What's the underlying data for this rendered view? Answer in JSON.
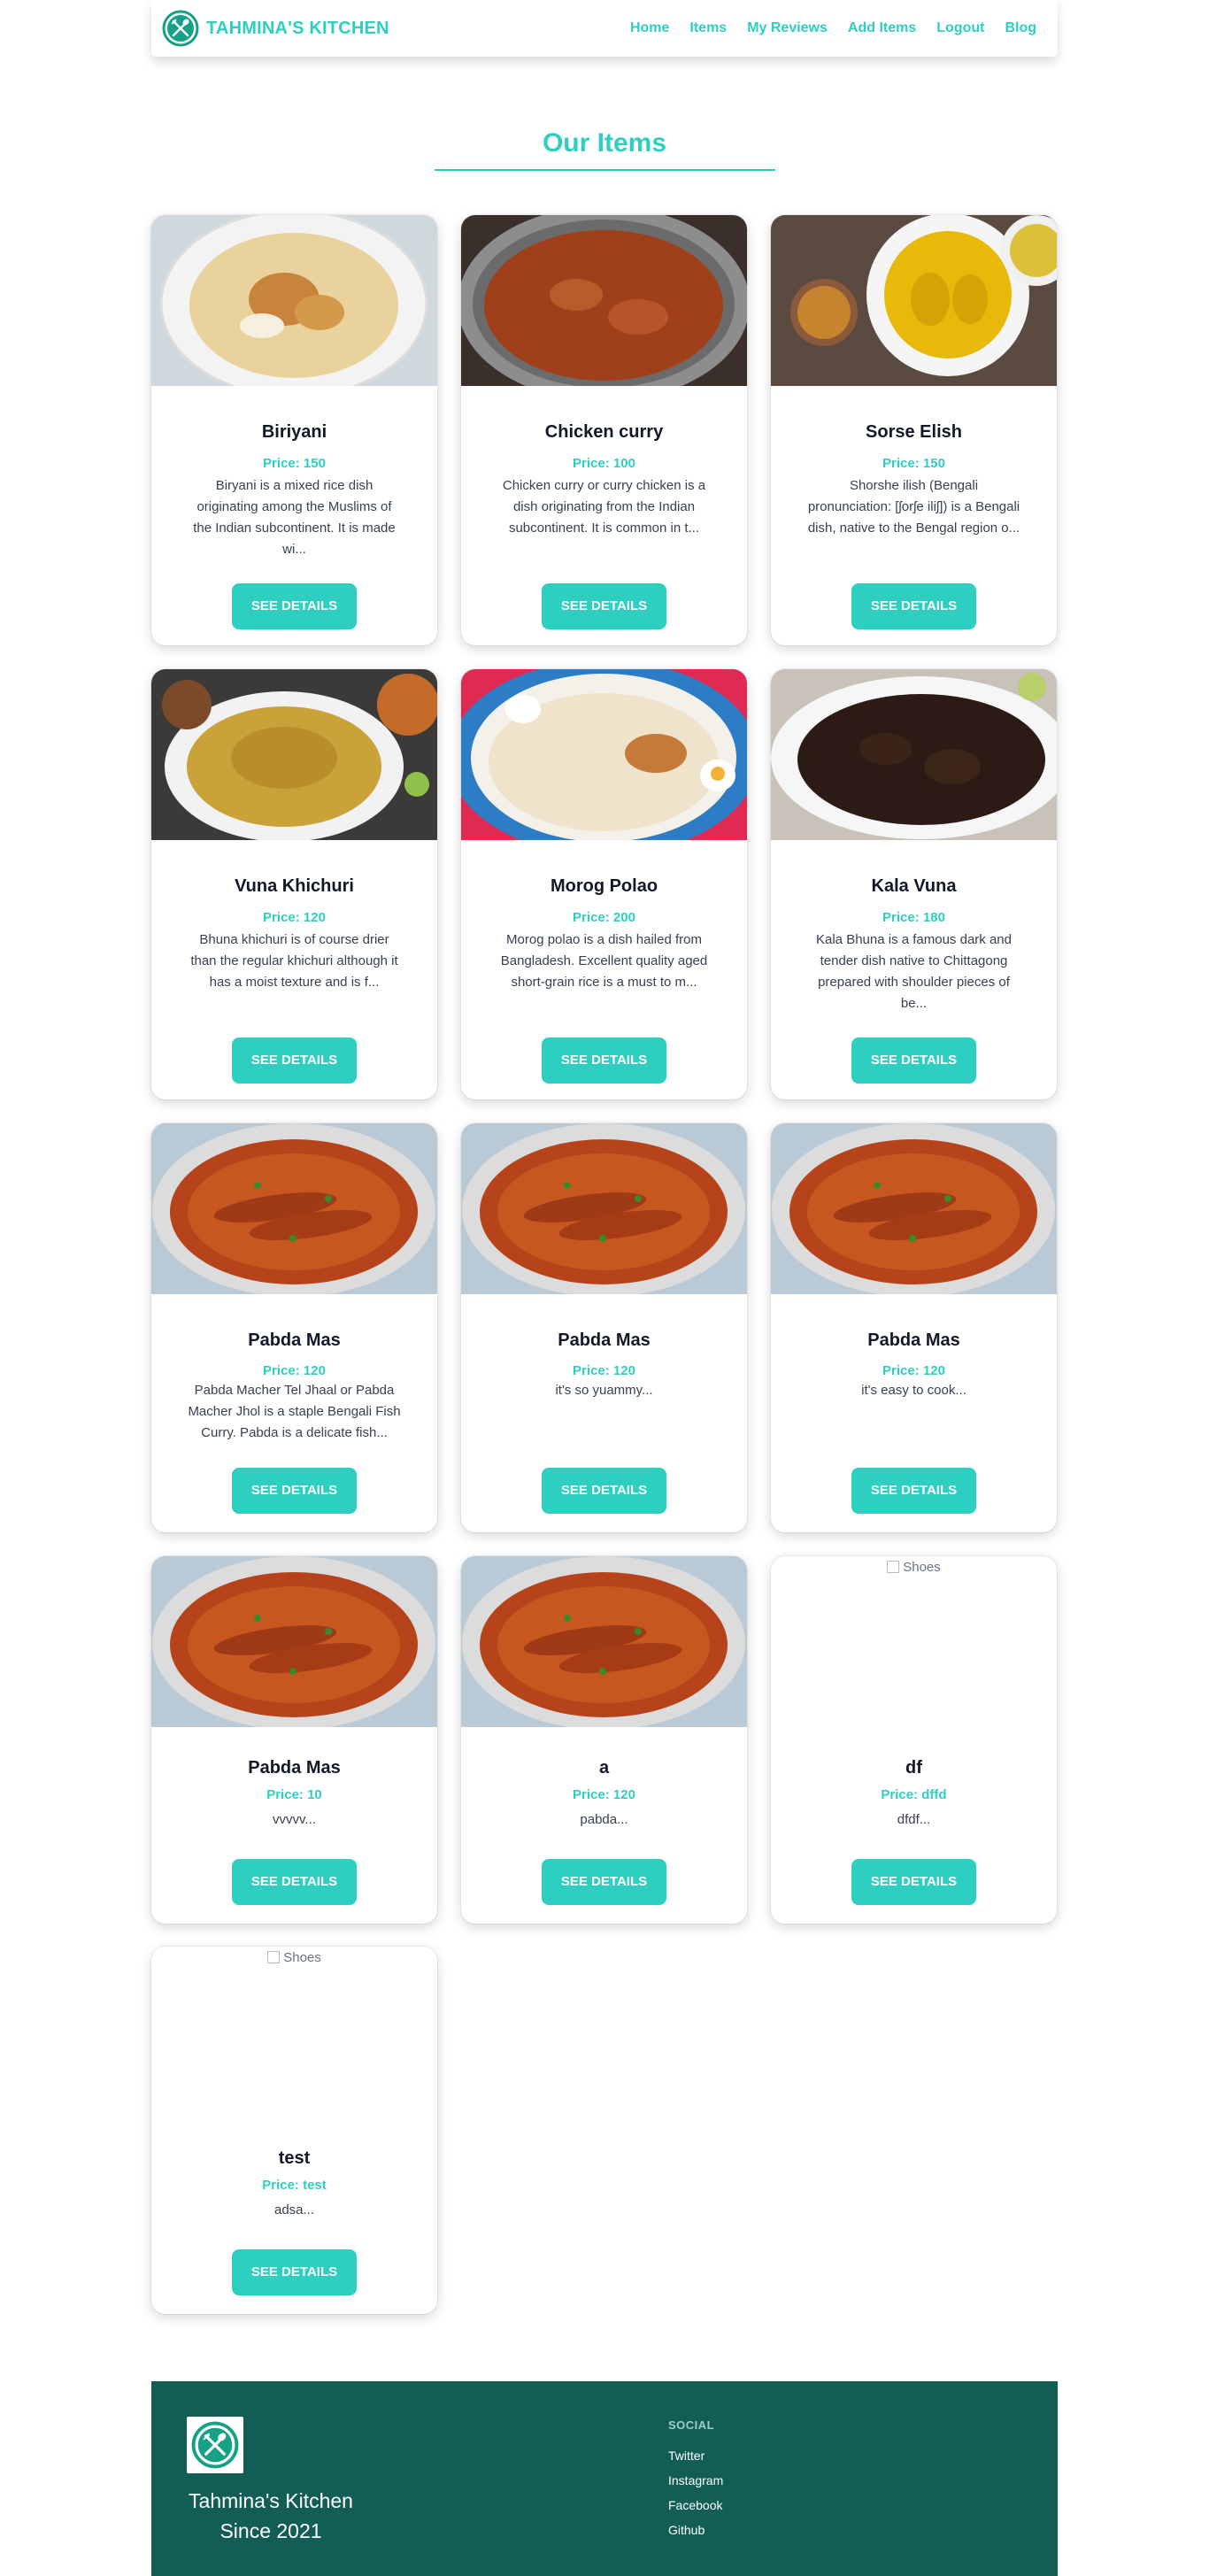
{
  "nav": {
    "brand": "TAHMINA'S KITCHEN",
    "links": [
      "Home",
      "Items",
      "My Reviews",
      "Add Items",
      "Logout",
      "Blog"
    ]
  },
  "section": {
    "title": "Our Items"
  },
  "button_label": "SEE DETAILS",
  "items": [
    {
      "title": "Biriyani",
      "price": "Price: 150",
      "desc": "Biryani is a mixed rice dish originating among the Muslims of the Indian subcontinent. It is made wi...",
      "img": "biriyani"
    },
    {
      "title": "Chicken curry",
      "price": "Price: 100",
      "desc": "Chicken curry or curry chicken is a dish originating from the Indian subcontinent. It is common in t...",
      "img": "curry"
    },
    {
      "title": "Sorse Elish",
      "price": "Price: 150",
      "desc": "Shorshe ilish (Bengali pronunciation: [ʃorʃe iliʃ]) is a Bengali dish, native to the Bengal region o...",
      "img": "elish"
    },
    {
      "title": "Vuna Khichuri",
      "price": "Price: 120",
      "desc": "Bhuna khichuri is of course drier than the regular khichuri although it has a moist texture and is f...",
      "img": "khichuri"
    },
    {
      "title": "Morog Polao",
      "price": "Price: 200",
      "desc": "Morog polao is a dish hailed from Bangladesh. Excellent quality aged short-grain rice is a must to m...",
      "img": "polao"
    },
    {
      "title": "Kala Vuna",
      "price": "Price: 180",
      "desc": "Kala Bhuna is a famous dark and tender dish native to Chittagong prepared with shoulder pieces of be...",
      "img": "kala"
    },
    {
      "title": "Pabda Mas",
      "price": "Price: 120",
      "desc": "Pabda Macher Tel Jhaal or Pabda Macher Jhol is a staple Bengali Fish Curry. Pabda is a delicate fish...",
      "img": "pabda"
    },
    {
      "title": "Pabda Mas",
      "price": "Price: 120",
      "desc": "it's so yuammy...",
      "img": "pabda"
    },
    {
      "title": "Pabda Mas",
      "price": "Price: 120",
      "desc": "it's easy to cook...",
      "img": "pabda"
    },
    {
      "title": "Pabda Mas",
      "price": "Price: 10",
      "desc": "vvvvv...",
      "img": "pabda"
    },
    {
      "title": "a",
      "price": "Price: 120",
      "desc": "pabda...",
      "img": "pabda"
    },
    {
      "title": "df",
      "price": "Price: dffd",
      "desc": "dfdf...",
      "img": "broken",
      "alt": "Shoes"
    },
    {
      "title": "test",
      "price": "Price: test",
      "desc": "adsa...",
      "img": "broken",
      "alt": "Shoes"
    }
  ],
  "footer": {
    "brand_line1": "Tahmina's Kitchen",
    "brand_line2": "Since 2021",
    "social_title": "SOCIAL",
    "social_links": [
      "Twitter",
      "Instagram",
      "Facebook",
      "Github"
    ]
  },
  "colors": {
    "accent": "#2ecfc0",
    "footer_bg": "#125e55"
  }
}
